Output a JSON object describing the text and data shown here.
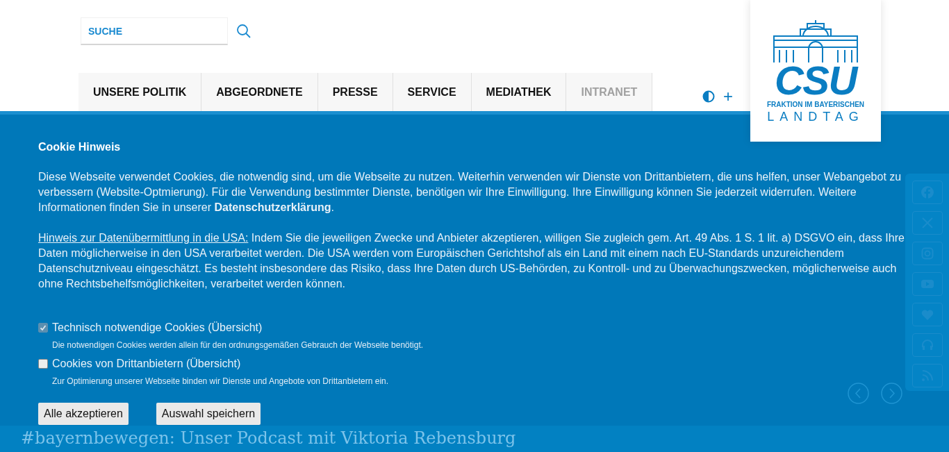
{
  "search": {
    "placeholder": "SUCHE"
  },
  "nav": [
    {
      "label": "UNSERE POLITIK",
      "disabled": false
    },
    {
      "label": "ABGEORDNETE",
      "disabled": false
    },
    {
      "label": "PRESSE",
      "disabled": false
    },
    {
      "label": "SERVICE",
      "disabled": false
    },
    {
      "label": "MEDIATHEK",
      "disabled": false
    },
    {
      "label": "INTRANET",
      "disabled": true
    }
  ],
  "header_tools": [
    "+"
  ],
  "logo": {
    "wordmark": "CSU",
    "line_1": "FRAKTION IM BAYERISCHEN",
    "line_2": "LANDTAG"
  },
  "cookie_notice": {
    "title": "Cookie Hinweis",
    "intro": "Diese Webseite verwendet Cookies, die notwendig sind, um die Webseite zu nutzen. Weiterhin verwenden wir Dienste von Drittanbietern, die uns helfen, unser Webangebot zu verbessern (Website-Optmierung). Für die Verwendung bestimmter Dienste, benötigen wir Ihre Einwilligung. Ihre Einwilligung können Sie jederzeit widerrufen. Weitere Informationen finden Sie in unserer **Datenschutzerklärung**.",
    "usa_link": "Hinweis zur Datenübermittlung in die USA:",
    "usa_text": "Indem Sie die jeweiligen Zwecke und Anbieter akzeptieren, willigen Sie zugleich gem. Art. 49 Abs. 1 S. 1 lit. a) DSGVO ein, dass Ihre Daten möglicherweise in den USA verarbeitet werden. Die USA werden vom Europäischen Gerichtshof als ein Land mit einem nach EU-Standards unzureichendem Datenschutzniveau eingeschätzt. Es besteht insbesondere das Risiko, dass Ihre Daten durch US-Behörden, zu Kontroll- und zu Überwachungszwecken, möglicherweise auch ohne Rechtsbehelfsmöglichkeiten, verarbeitet werden können.",
    "options": [
      {
        "label": "Technisch notwendige Cookies (Übersicht)",
        "description": "Die notwendigen Cookies werden allein für den ordnungsgemäßen Gebrauch der Webseite benötigt.",
        "checked": true,
        "disabled": true
      },
      {
        "label": "Cookies von Drittanbietern (Übersicht)",
        "description": "Zur Optimierung unserer Webseite binden wir Dienste und Angebote von Drittanbietern ein.",
        "checked": false,
        "disabled": false
      }
    ],
    "buttons": [
      "Alle akzeptieren",
      "Auswahl speichern"
    ]
  },
  "social": [
    {
      "kind": "facebook"
    },
    {
      "kind": "x"
    },
    {
      "kind": "instagram"
    },
    {
      "kind": "youtube"
    },
    {
      "kind": "heart"
    },
    {
      "kind": "podcast"
    },
    {
      "kind": "rss"
    }
  ],
  "headline": "#bayernbewegen: Unser Podcast mit Viktoria Rebensburg"
}
